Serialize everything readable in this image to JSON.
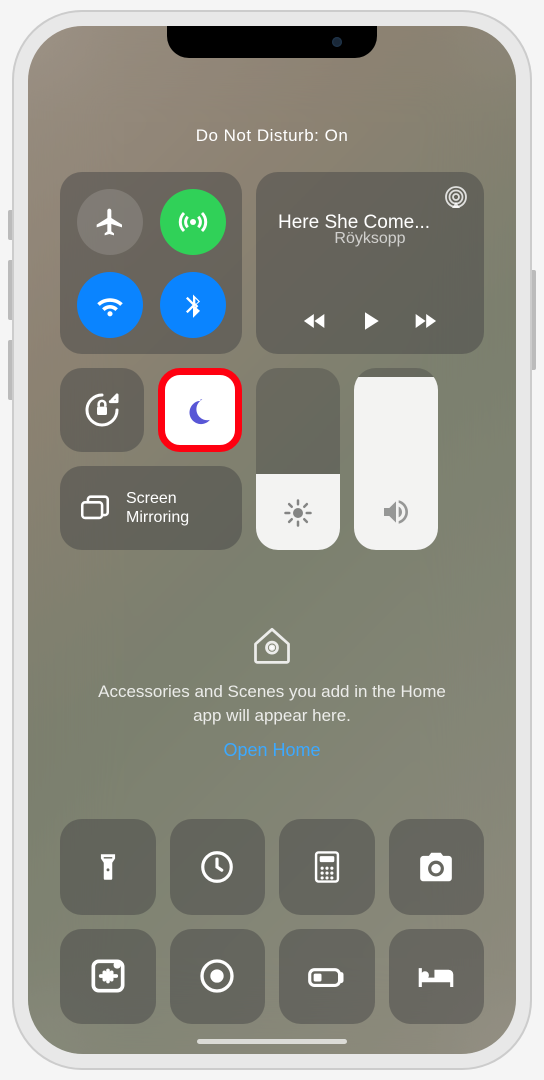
{
  "status": {
    "text": "Do Not Disturb: On"
  },
  "connectivity": {
    "airplane": false,
    "cellular": true,
    "wifi": true,
    "bluetooth": true
  },
  "media": {
    "title": "Here She Come...",
    "artist": "Röyksopp"
  },
  "screenMirror": {
    "label": "Screen\nMirroring"
  },
  "brightness": {
    "level_pct": 42
  },
  "volume": {
    "level_pct": 95
  },
  "home": {
    "text": "Accessories and Scenes you add in the Home app will appear here.",
    "link": "Open Home"
  }
}
